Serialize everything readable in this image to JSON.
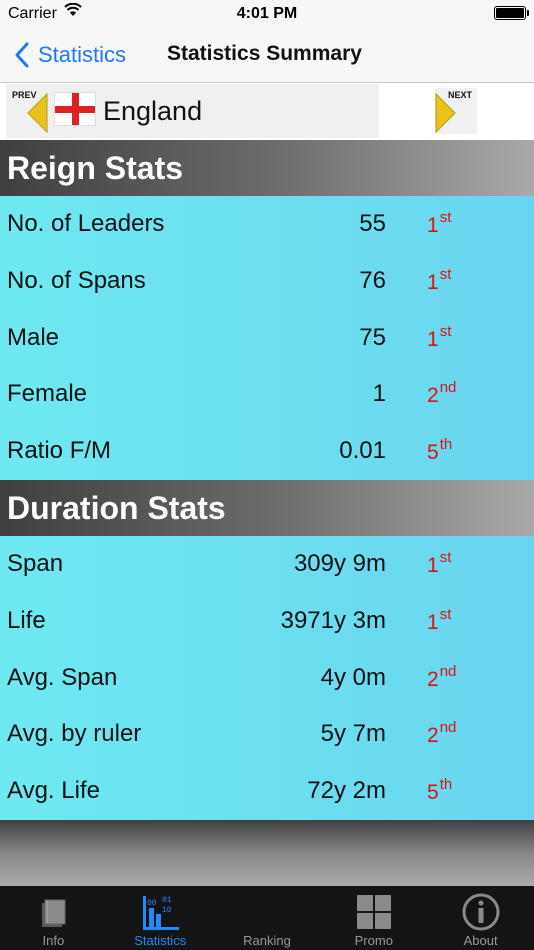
{
  "status_bar": {
    "carrier": "Carrier",
    "time": "4:01 PM"
  },
  "nav": {
    "back_label": "Statistics",
    "title": "Statistics Summary"
  },
  "country": {
    "name": "England",
    "prev_label": "PREV",
    "next_label": "NEXT"
  },
  "sections": [
    {
      "title": "Reign Stats",
      "rows": [
        {
          "label": "No. of Leaders",
          "value": "55",
          "rank": "1",
          "suffix": "st"
        },
        {
          "label": "No. of Spans",
          "value": "76",
          "rank": "1",
          "suffix": "st"
        },
        {
          "label": "Male",
          "value": "75",
          "rank": "1",
          "suffix": "st"
        },
        {
          "label": "Female",
          "value": "1",
          "rank": "2",
          "suffix": "nd"
        },
        {
          "label": "Ratio F/M",
          "value": "0.01",
          "rank": "5",
          "suffix": "th"
        }
      ]
    },
    {
      "title": "Duration Stats",
      "rows": [
        {
          "label": "Span",
          "value": "309y 9m",
          "rank": "1",
          "suffix": "st"
        },
        {
          "label": "Life",
          "value": "3971y 3m",
          "rank": "1",
          "suffix": "st"
        },
        {
          "label": "Avg. Span",
          "value": "4y 0m",
          "rank": "2",
          "suffix": "nd"
        },
        {
          "label": "Avg. by ruler",
          "value": "5y 7m",
          "rank": "2",
          "suffix": "nd"
        },
        {
          "label": "Avg. Life",
          "value": "72y 2m",
          "rank": "5",
          "suffix": "th"
        }
      ]
    }
  ],
  "tabs": [
    {
      "label": "Info",
      "icon": "book-icon",
      "active": false
    },
    {
      "label": "Statistics",
      "icon": "statistics-icon",
      "active": true
    },
    {
      "label": "Ranking",
      "icon": "ranking-icon",
      "active": false
    },
    {
      "label": "Promo",
      "icon": "grid-icon",
      "active": false
    },
    {
      "label": "About",
      "icon": "info-icon",
      "active": false
    }
  ],
  "colors": {
    "accent": "#1F8BFF",
    "rank_red": "#DD1111",
    "row_bg": "#6EE9F1"
  }
}
